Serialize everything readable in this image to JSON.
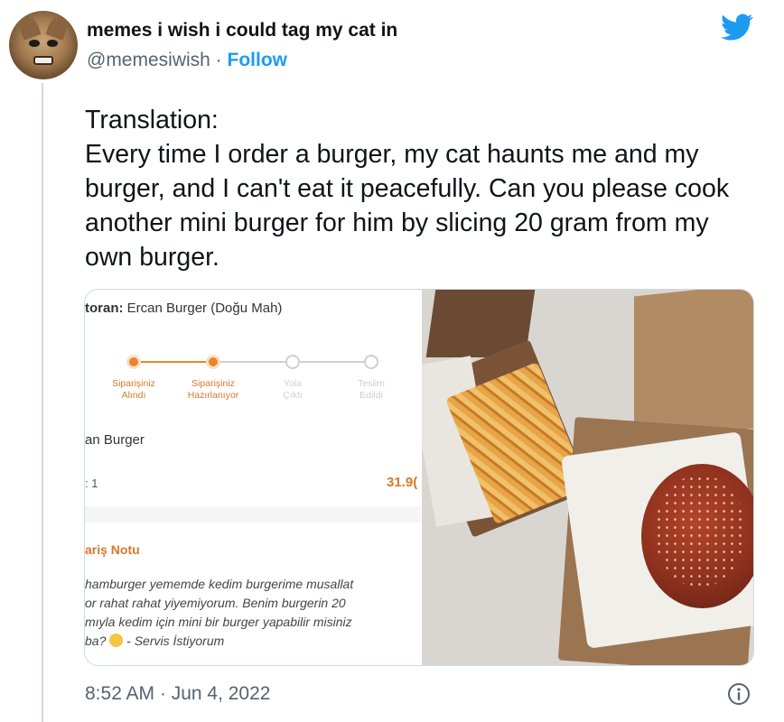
{
  "author": {
    "display_name": "memes i wish i could tag my cat in",
    "handle": "@memesiwish",
    "separator": " · ",
    "follow_label": "Follow"
  },
  "tweet": {
    "text": "Translation:\nEvery time I order a burger, my cat haunts me and my burger, and I can't eat it peacefully. Can you please cook another mini burger for him by slicing 20 gram from my own burger.",
    "timestamp": "8:52 AM · Jun 4, 2022"
  },
  "order_screenshot": {
    "restaurant_label": "toran:",
    "restaurant_name": " Ercan Burger (Doğu Mah)",
    "steps": [
      {
        "label": "Siparişiniz\nAlındı",
        "status": "done"
      },
      {
        "label": "Siparişiniz\nHazırlanıyor",
        "status": "done"
      },
      {
        "label": "Yola\nÇıktı",
        "status": "pending"
      },
      {
        "label": "Teslim\nEdildi",
        "status": "pending"
      }
    ],
    "product_name": "an Burger",
    "quantity": ": 1",
    "price": "31.9(",
    "note_title": "ariş Notu",
    "note_body": "hamburger yememde kedim burgerime musallat\nor rahat rahat yiyemiyorum. Benim burgerin 20\nmıyla kedim için mini bir burger yapabilir misiniz\nba? ",
    "note_suffix": " - Servis İstiyorum"
  },
  "colors": {
    "link_blue": "#1d9bf0",
    "order_orange": "#e8862c",
    "muted_text": "#536471"
  },
  "icons": [
    "twitter-bird-icon",
    "info-icon",
    "pleading-face-emoji"
  ]
}
